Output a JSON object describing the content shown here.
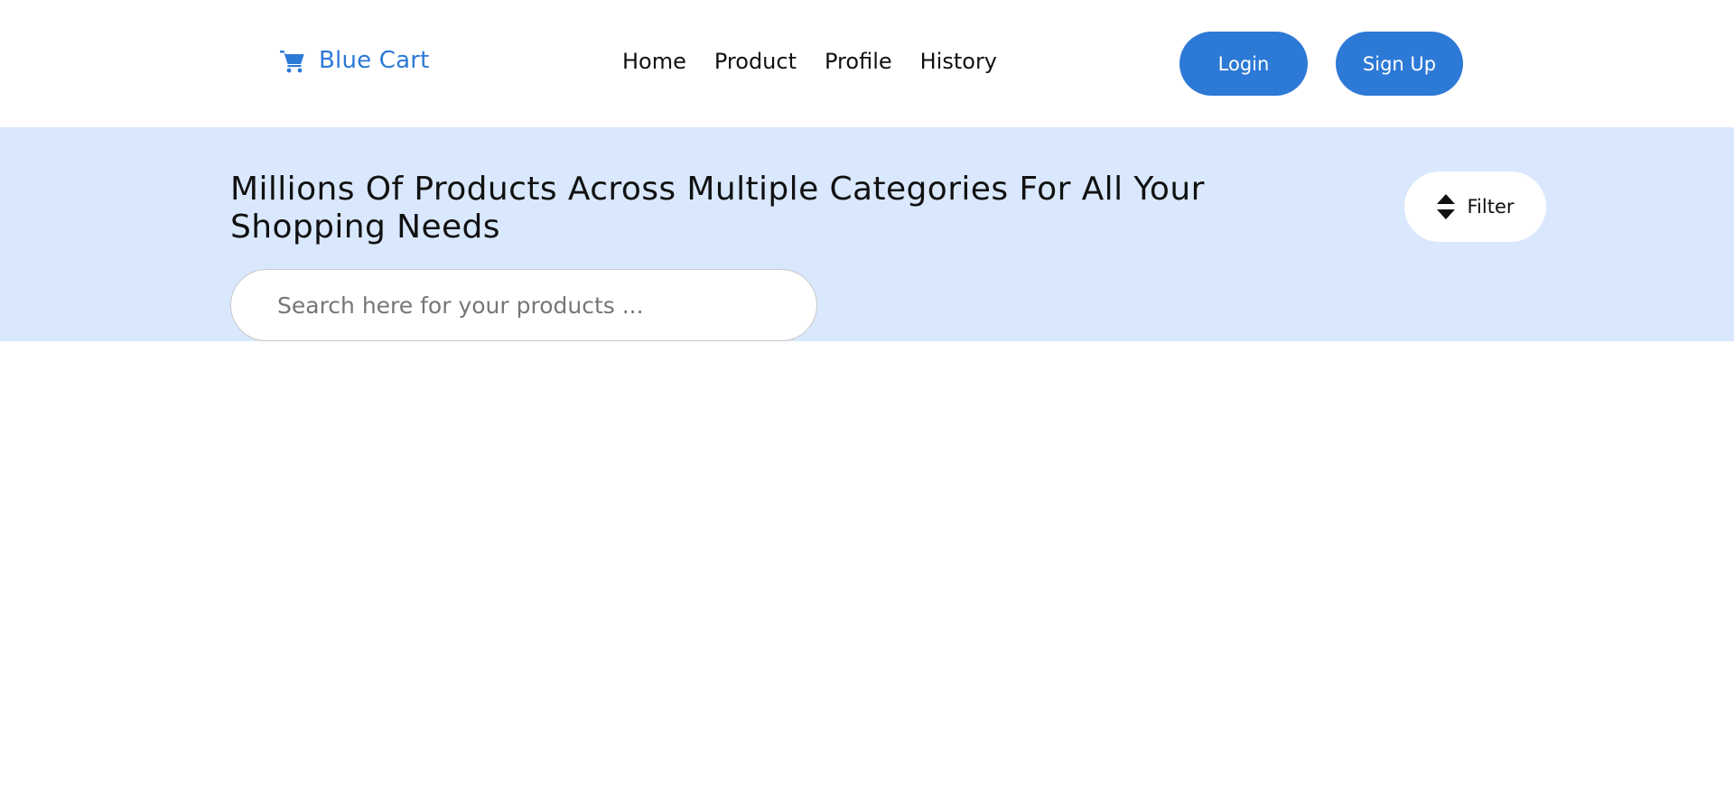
{
  "brand": {
    "name": "Blue Cart",
    "icon": "cart-icon",
    "color": "#2d79d6"
  },
  "nav": {
    "links": [
      "Home",
      "Product",
      "Profile",
      "History"
    ]
  },
  "auth": {
    "login_label": "Login",
    "signup_label": "Sign Up",
    "button_color": "#2d79d6"
  },
  "hero": {
    "title": "Millions Of Products Across Multiple Categories For All Your Shopping Needs",
    "background": "#d9e8fc"
  },
  "filter": {
    "label": "Filter",
    "icon": "sort-icon"
  },
  "search": {
    "value": "",
    "placeholder": "Search here for your products ..."
  }
}
